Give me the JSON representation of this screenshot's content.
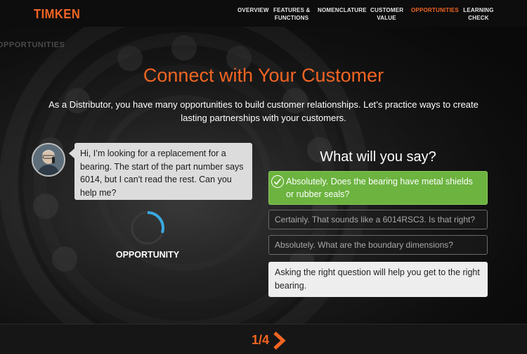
{
  "brand": {
    "logo": "TIMKEN",
    "accent": "#f26522"
  },
  "nav": {
    "items": [
      {
        "label": "OVERVIEW",
        "active": false
      },
      {
        "label": "FEATURES &\nFUNCTIONS",
        "active": false
      },
      {
        "label": "NOMENCLATURE",
        "active": false
      },
      {
        "label": "CUSTOMER\nVALUE",
        "active": false
      },
      {
        "label": "OPPORTUNITIES",
        "active": true
      },
      {
        "label": "LEARNING\nCHECK",
        "active": false
      }
    ]
  },
  "watermark": "OPPORTUNITIES",
  "main": {
    "title": "Connect with Your Customer",
    "subtitle": "As a Distributor, you have many opportunities to build customer relationships. Let’s practice ways to create lasting partnerships with your customers."
  },
  "customer": {
    "speech": "Hi, I’m looking for a replacement for a bearing. The start of the part number says 6014, but I can't read the rest. Can you help me?"
  },
  "progress": {
    "label": "OPPORTUNITY",
    "fraction": 0.3,
    "color": "#3aa8e0"
  },
  "quiz": {
    "question": "What will you say?",
    "options": [
      {
        "label": "Absolutely. Does the bearing have metal shields or rubber seals?",
        "state": "correct",
        "color": "#6cb33f"
      },
      {
        "label": "Certainly. That sounds like a 6014RSC3. Is that right?",
        "state": "dimmed"
      },
      {
        "label": "Absolutely. What are the boundary dimensions?",
        "state": "dimmed"
      }
    ],
    "feedback": "Asking the right question will help you get to the right bearing."
  },
  "pagination": {
    "current": 1,
    "total": 4,
    "text": "1/4"
  }
}
